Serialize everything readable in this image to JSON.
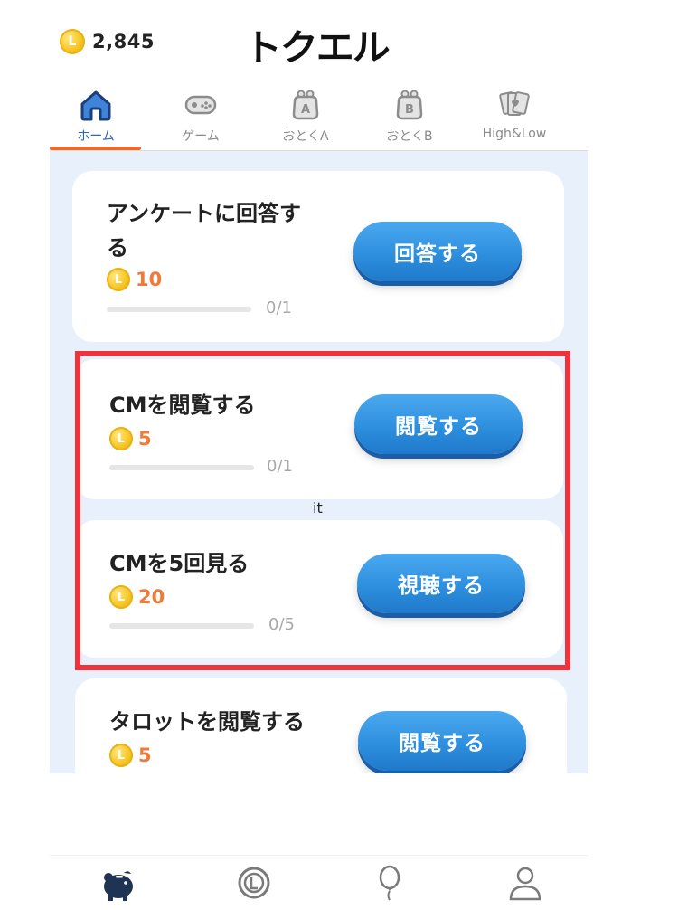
{
  "header": {
    "coin_balance": "2,845",
    "app_title": "トクエル",
    "coin_symbol": "L"
  },
  "tabs": [
    {
      "label": "ホーム",
      "icon": "home-icon",
      "active": true
    },
    {
      "label": "ゲーム",
      "icon": "gamepad-icon",
      "active": false
    },
    {
      "label": "おとくA",
      "icon": "purse-a-icon",
      "active": false
    },
    {
      "label": "おとくB",
      "icon": "purse-b-icon",
      "active": false
    },
    {
      "label": "High&Low",
      "icon": "playing-cards-icon",
      "active": false
    }
  ],
  "tasks": [
    {
      "title_line1": "アンケートに回答す",
      "title_line2": "る",
      "reward": "10",
      "progress": "0/1",
      "progress_fraction": 0,
      "button": "回答する"
    },
    {
      "title": "CMを閲覧する",
      "reward": "5",
      "progress": "0/1",
      "progress_fraction": 0,
      "button": "閲覧する"
    },
    {
      "title": "CMを5回見る",
      "reward": "20",
      "progress": "0/5",
      "progress_fraction": 0,
      "button": "視聴する"
    },
    {
      "title": "タロットを閲覧する",
      "reward": "5",
      "button": "閲覧する"
    }
  ],
  "annotation": {
    "label": "it",
    "color": "#f2323a"
  },
  "bottom_nav": [
    {
      "icon": "piggy-bank-icon"
    },
    {
      "icon": "coin-icon"
    },
    {
      "icon": "balloon-icon"
    },
    {
      "icon": "user-icon"
    }
  ],
  "colors": {
    "accent_blue": "#2e8fdf",
    "reward_orange": "#f07a3a",
    "tab_active": "#2c66b6",
    "panel_bg": "#e7f0fb"
  }
}
